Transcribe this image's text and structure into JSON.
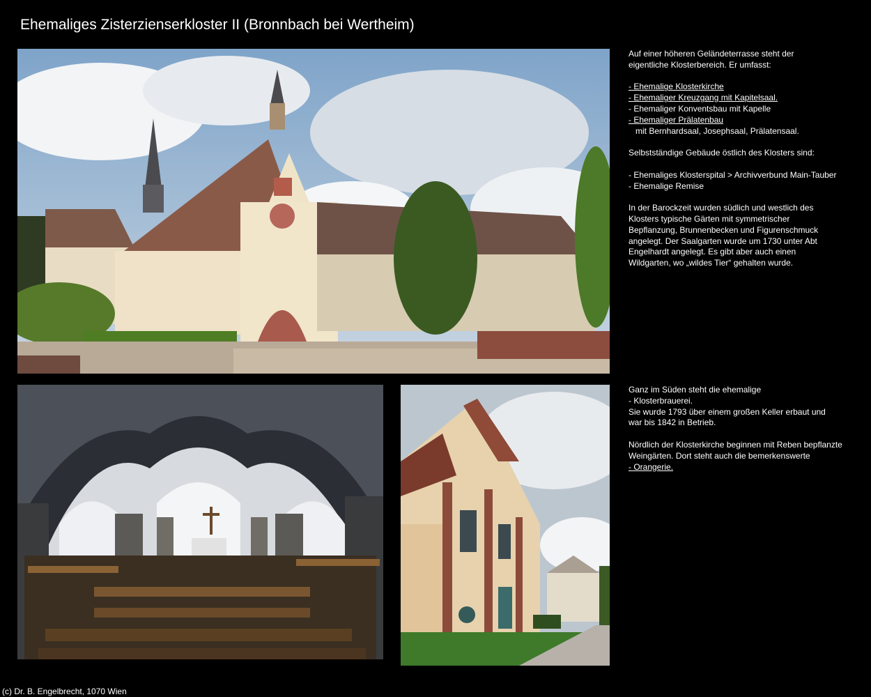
{
  "page": {
    "title": "Ehemaliges Zisterzienserkloster II (Bronnbach bei Wertheim)",
    "footer": "(c) Dr. B. Engelbrecht, 1070 Wien"
  },
  "text_top": {
    "intro_line1": "Auf einer höheren Geländeterrasse steht der",
    "intro_line2": "eigentliche Klosterbereich. Er umfasst:",
    "items": [
      "- Ehemalige Klosterkirche",
      "- Ehemaliger Kreuzgang mit Kapitelsaal.",
      "- Ehemaliger Konventsbau mit Kapelle",
      "- Ehemaliger Prälatenbau",
      "mit Bernhardsaal, Josephsaal, Prälatensaal."
    ],
    "east_heading": "Selbstständige Gebäude östlich des Klosters sind:",
    "east_items": [
      "- Ehemaliges Klosterspital > Archivverbund Main-Tauber",
      "- Ehemalige Remise"
    ],
    "baroque_lines": [
      "In der Barockzeit wurden südlich und westlich des",
      "Klosters typische Gärten mit symmetrischer",
      "Bepflanzung, Brunnenbecken und Figurenschmuck",
      "angelegt. Der Saalgarten wurde um 1730 unter Abt",
      "Engelhardt angelegt. Es gibt aber auch einen",
      "Wildgarten, wo „wildes Tier“ gehalten wurde."
    ]
  },
  "text_bottom": {
    "lines": [
      "Ganz im Süden steht die ehemalige",
      "- Klosterbrauerei.",
      "Sie wurde 1793 über einem großen Keller erbaut und",
      "war bis 1842 in Betrieb."
    ],
    "north_lines": [
      "Nördlich der Klosterkirche beginnen mit Reben bepflanzte",
      "Weingärten. Dort steht auch die bemerkenswerte"
    ],
    "orangery_link": "- Orangerie."
  }
}
